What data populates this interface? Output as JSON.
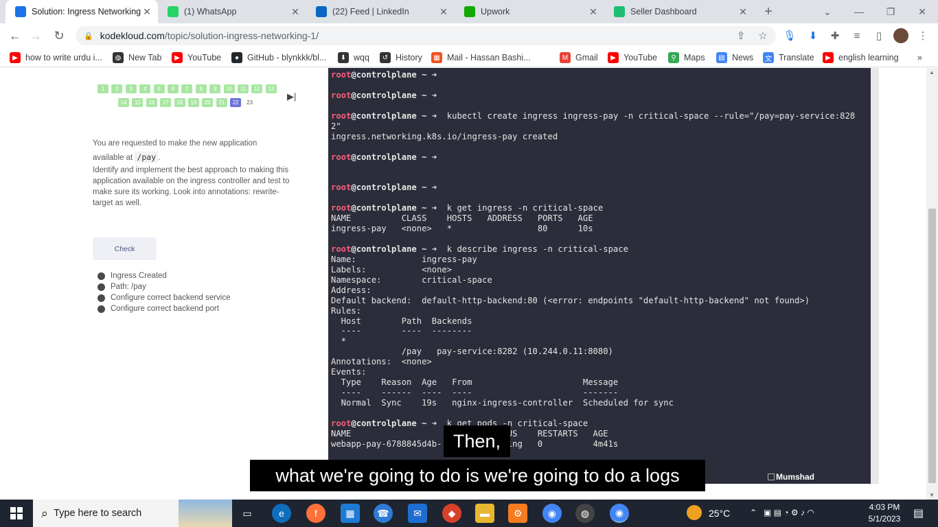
{
  "browser": {
    "tabs": [
      {
        "title": "Solution: Ingress Networking",
        "icon": "kodekloud-icon",
        "color": "#1a73e8",
        "active": true
      },
      {
        "title": "(1) WhatsApp",
        "icon": "whatsapp-icon",
        "color": "#25d366",
        "active": false
      },
      {
        "title": "(22) Feed | LinkedIn",
        "icon": "linkedin-icon",
        "color": "#0a66c2",
        "active": false
      },
      {
        "title": "Upwork",
        "icon": "upwork-icon",
        "color": "#14a800",
        "active": false
      },
      {
        "title": "Seller Dashboard",
        "icon": "fiverr-icon",
        "color": "#1dbf73",
        "active": false
      }
    ],
    "new_tab_symbol": "+",
    "url_host": "kodekloud.com",
    "url_path": "/topic/solution-ingress-networking-1/"
  },
  "bookmarks": [
    {
      "label": "how to write urdu i...",
      "icon": "youtube-icon",
      "color": "#ff0000"
    },
    {
      "label": "New Tab",
      "icon": "globe-icon",
      "color": "#333333"
    },
    {
      "label": "YouTube",
      "icon": "youtube-icon",
      "color": "#ff0000"
    },
    {
      "label": "GitHub - blynkkk/bl...",
      "icon": "github-icon",
      "color": "#24292e"
    },
    {
      "label": "wqq",
      "icon": "download-icon",
      "color": "#333333"
    },
    {
      "label": "History",
      "icon": "history-icon",
      "color": "#333333"
    },
    {
      "label": "Mail - Hassan Bashi...",
      "icon": "microsoft-icon",
      "color": "#f25022"
    },
    {
      "label": "Gmail",
      "icon": "gmail-icon",
      "color": "#ea4335"
    },
    {
      "label": "YouTube",
      "icon": "youtube-icon",
      "color": "#ff0000"
    },
    {
      "label": "Maps",
      "icon": "maps-icon",
      "color": "#34a853"
    },
    {
      "label": "News",
      "icon": "news-icon",
      "color": "#4285f4"
    },
    {
      "label": "Translate",
      "icon": "translate-icon",
      "color": "#4285f4"
    },
    {
      "label": "english learning",
      "icon": "youtube-icon",
      "color": "#ff0000"
    }
  ],
  "lab": {
    "question_numbers_row1": [
      "1",
      "2",
      "3",
      "4",
      "5",
      "6",
      "7",
      "8",
      "9",
      "10",
      "11",
      "12",
      "13"
    ],
    "question_numbers_row2": [
      "14",
      "15",
      "16",
      "17",
      "18",
      "19",
      "20",
      "21",
      "22",
      "23"
    ],
    "current_question": "22",
    "task_line1": "You are requested to make the new application",
    "task_line2_prefix": "available at",
    "task_code": "/pay",
    "task_line2_suffix": ".",
    "task_body": "Identify and implement the best approach to making this application available on the ingress controller and test to make sure its working. Look into annotations: rewrite-target as well.",
    "check_label": "Check",
    "criteria": [
      "Ingress Created",
      "Path: /pay",
      "Configure correct backend service",
      "Configure correct backend port"
    ]
  },
  "terminal": {
    "prompt_user": "root",
    "prompt_host": "@controlplane ~ ➜",
    "lines": [
      {
        "p": true,
        "cmd": ""
      },
      {
        "p": false,
        "text": ""
      },
      {
        "p": true,
        "cmd": ""
      },
      {
        "p": false,
        "text": ""
      },
      {
        "p": true,
        "cmd": "  kubectl create ingress ingress-pay -n critical-space --rule=\"/pay=pay-service:828"
      },
      {
        "p": false,
        "text": "2\""
      },
      {
        "p": false,
        "text": "ingress.networking.k8s.io/ingress-pay created"
      },
      {
        "p": false,
        "text": ""
      },
      {
        "p": true,
        "cmd": ""
      },
      {
        "p": false,
        "text": ""
      },
      {
        "p": false,
        "text": ""
      },
      {
        "p": true,
        "cmd": ""
      },
      {
        "p": false,
        "text": ""
      },
      {
        "p": true,
        "cmd": "  k get ingress -n critical-space"
      },
      {
        "p": false,
        "text": "NAME          CLASS    HOSTS   ADDRESS   PORTS   AGE"
      },
      {
        "p": false,
        "text": "ingress-pay   <none>   *                 80      10s"
      },
      {
        "p": false,
        "text": ""
      },
      {
        "p": true,
        "cmd": "  k describe ingress -n critical-space"
      },
      {
        "p": false,
        "text": "Name:             ingress-pay"
      },
      {
        "p": false,
        "text": "Labels:           <none>"
      },
      {
        "p": false,
        "text": "Namespace:        critical-space"
      },
      {
        "p": false,
        "text": "Address:"
      },
      {
        "p": false,
        "text": "Default backend:  default-http-backend:80 (<error: endpoints \"default-http-backend\" not found>)"
      },
      {
        "p": false,
        "text": "Rules:"
      },
      {
        "p": false,
        "text": "  Host        Path  Backends"
      },
      {
        "p": false,
        "text": "  ----        ----  --------"
      },
      {
        "p": false,
        "text": "  *"
      },
      {
        "p": false,
        "text": "              /pay   pay-service:8282 (10.244.0.11:8080)"
      },
      {
        "p": false,
        "text": "Annotations:  <none>"
      },
      {
        "p": false,
        "text": "Events:"
      },
      {
        "p": false,
        "text": "  Type    Reason  Age   From                      Message"
      },
      {
        "p": false,
        "text": "  ----    ------  ----  ----                      -------"
      },
      {
        "p": false,
        "text": "  Normal  Sync    19s   nginx-ingress-controller  Scheduled for sync"
      },
      {
        "p": false,
        "text": ""
      },
      {
        "p": true,
        "cmd": "  k get pods -n critical-space"
      },
      {
        "p": false,
        "text": "NAME                           STATUS    RESTARTS   AGE"
      },
      {
        "p": false,
        "text": "webapp-pay-6788845d4b-         Running   0          4m41s"
      }
    ]
  },
  "captions": {
    "line1": "Then,",
    "line2": "what we're going to do is we're going to do a logs"
  },
  "watermark": "Mumshad",
  "taskbar": {
    "search_placeholder": "Type here to search",
    "weather": "25°C",
    "time": "4:03 PM",
    "date": "5/1/2023"
  }
}
